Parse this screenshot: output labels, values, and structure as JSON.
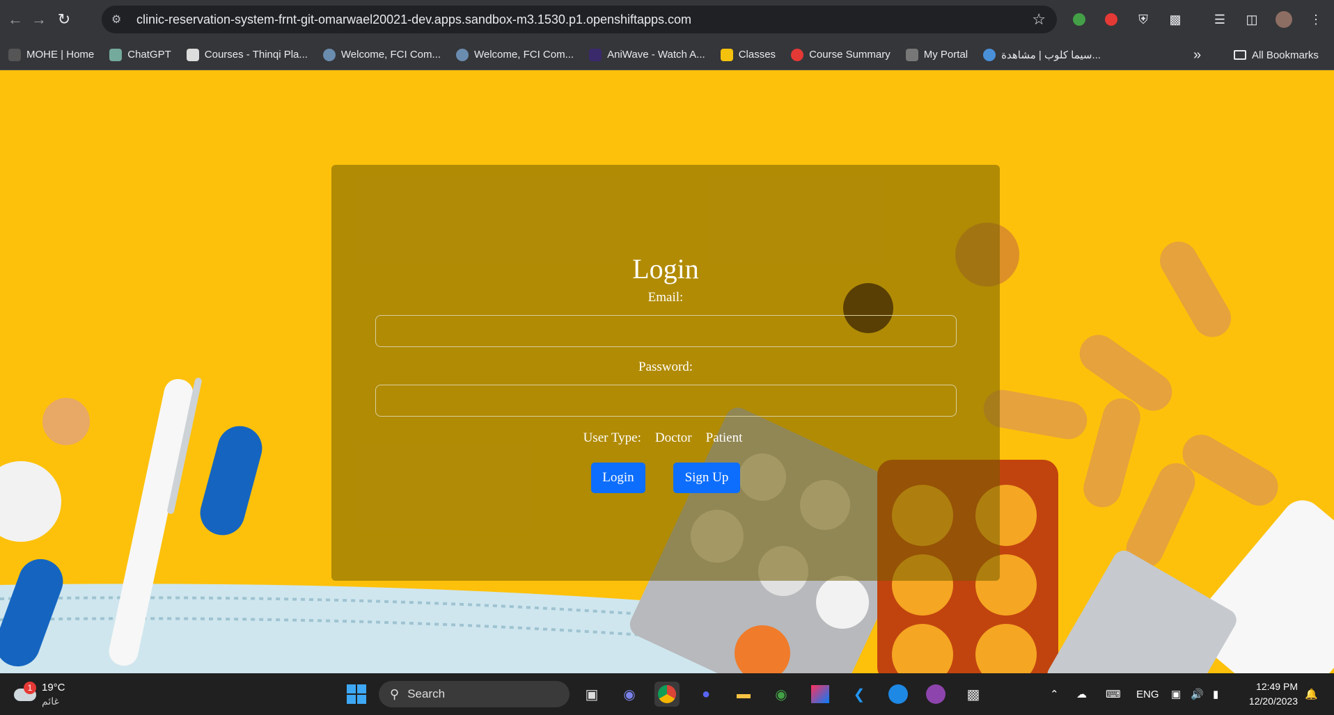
{
  "browser": {
    "url": "clinic-reservation-system-frnt-git-omarwael20021-dev.apps.sandbox-m3.1530.p1.openshiftapps.com",
    "bookmarks": [
      {
        "label": "MOHE | Home",
        "color": "#555"
      },
      {
        "label": "ChatGPT",
        "color": "#74aa9c"
      },
      {
        "label": "Courses - Thinqi Pla...",
        "color": "#ddd"
      },
      {
        "label": "Welcome, FCI Com...",
        "color": "#6a8caf"
      },
      {
        "label": "Welcome, FCI Com...",
        "color": "#6a8caf"
      },
      {
        "label": "AniWave - Watch A...",
        "color": "#3b2a6b"
      },
      {
        "label": "Classes",
        "color": "#f4c20d"
      },
      {
        "label": "Course Summary",
        "color": "#e53935"
      },
      {
        "label": "My Portal",
        "color": "#777"
      },
      {
        "label": "سيما كلوب | مشاهدة...",
        "color": "#4a90d9"
      }
    ],
    "more_label": "»",
    "all_bookmarks_label": "All Bookmarks"
  },
  "login": {
    "title": "Login",
    "email_label": "Email:",
    "email_value": "",
    "password_label": "Password:",
    "password_value": "",
    "user_type_label": "User Type:",
    "user_type_options": [
      "Doctor",
      "Patient"
    ],
    "login_button": "Login",
    "signup_button": "Sign Up",
    "accent_color": "#0d6efd"
  },
  "taskbar": {
    "weather_temp": "19°C",
    "weather_desc": "غائم",
    "weather_badge": "1",
    "search_label": "Search",
    "lang": "ENG",
    "time": "12:49 PM",
    "date": "12/20/2023"
  }
}
